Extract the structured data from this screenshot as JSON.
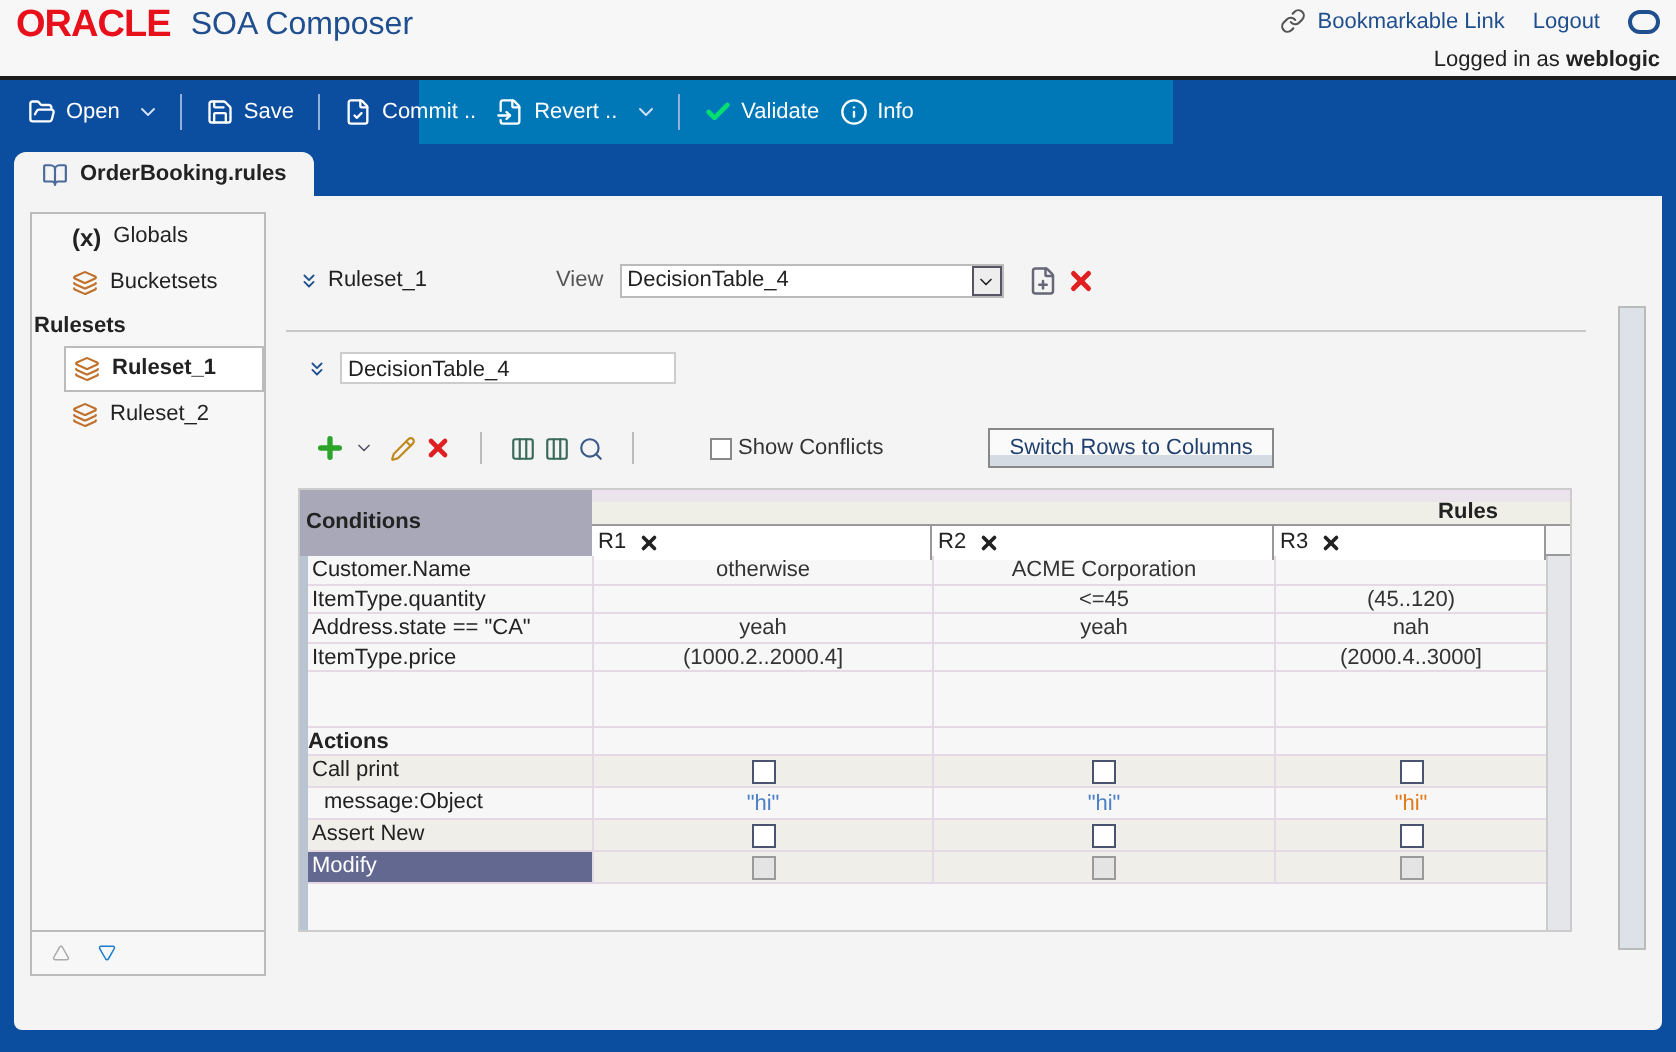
{
  "header": {
    "logo": "ORACLE",
    "product": "SOA Composer",
    "links": [
      "Bookmarkable Link",
      "Logout"
    ],
    "login": "Logged in as **weblogic**"
  },
  "toolbar": [
    {
      "kind": "folder",
      "label": "Open",
      "dropdown": true,
      "separator": true
    },
    {
      "kind": "disk",
      "label": "Save",
      "dropdown": false,
      "separator": true
    },
    {
      "kind": "commit",
      "label": "Commit ..",
      "dropdown": false,
      "separator": false
    },
    {
      "kind": "revert",
      "label": "Revert ..",
      "dropdown": true,
      "separator": true
    },
    {
      "kind": "check",
      "label": "Validate",
      "dropdown": false,
      "separator": false
    },
    {
      "kind": "info",
      "label": "Info",
      "dropdown": false,
      "separator": false
    }
  ],
  "document_tab": "OrderBooking.rules",
  "sidebar": {
    "items": [
      {
        "kind": "globals",
        "icon_text": "(x)",
        "label": "Globals"
      },
      {
        "kind": "bucket",
        "label": "Bucketsets"
      }
    ],
    "section_title": "Rulesets",
    "rulesets": [
      {
        "label": "Ruleset_1",
        "selected": true
      },
      {
        "label": "Ruleset_2",
        "selected": false
      }
    ]
  },
  "ruleset": {
    "name": "Ruleset_1",
    "view_label": "View",
    "view_value": "DecisionTable_4"
  },
  "decision_table": {
    "name": "DecisionTable_4",
    "show_conflicts": {
      "label": "Show Conflicts",
      "checked": false
    },
    "switch_button": "Switch Rows to Columns",
    "conditions_title": "Conditions",
    "rules_title": "Rules",
    "rules": [
      "R1",
      "R2",
      "R3"
    ],
    "condition_rows": [
      {
        "label": "Customer.Name",
        "cells": [
          "otherwise",
          "ACME Corporation",
          null
        ]
      },
      {
        "label": "ItemType.quantity",
        "cells": [
          null,
          "<=45",
          "(45..120)"
        ]
      },
      {
        "label": "Address.state == \"CA\"",
        "cells": [
          "yeah",
          "yeah",
          "nah"
        ]
      },
      {
        "label": "ItemType.price",
        "cells": [
          "(1000.2..2000.4]",
          null,
          "(2000.4..3000]"
        ]
      }
    ],
    "actions_title": "Actions",
    "action_rows": [
      {
        "kind": "action",
        "label": "Call print",
        "selected": false,
        "cells": [
          {
            "checked": false,
            "disabled": false
          },
          {
            "checked": false,
            "disabled": false
          },
          {
            "checked": false,
            "disabled": false
          }
        ]
      },
      {
        "kind": "param",
        "label": "message:Object",
        "selected": false,
        "cells": [
          {
            "text": "\"hi\"",
            "color": "#4a7fc8"
          },
          {
            "text": "\"hi\"",
            "color": "#4a7fc8"
          },
          {
            "text": "\"hi\"",
            "color": "#e07a1a"
          }
        ]
      },
      {
        "kind": "action",
        "label": "Assert New",
        "selected": false,
        "cells": [
          {
            "checked": false,
            "disabled": false
          },
          {
            "checked": false,
            "disabled": false
          },
          {
            "checked": false,
            "disabled": false
          }
        ]
      },
      {
        "kind": "action",
        "label": "Modify",
        "selected": true,
        "cells": [
          {
            "checked": false,
            "disabled": true
          },
          {
            "checked": false,
            "disabled": true
          },
          {
            "checked": false,
            "disabled": true
          }
        ]
      }
    ]
  }
}
